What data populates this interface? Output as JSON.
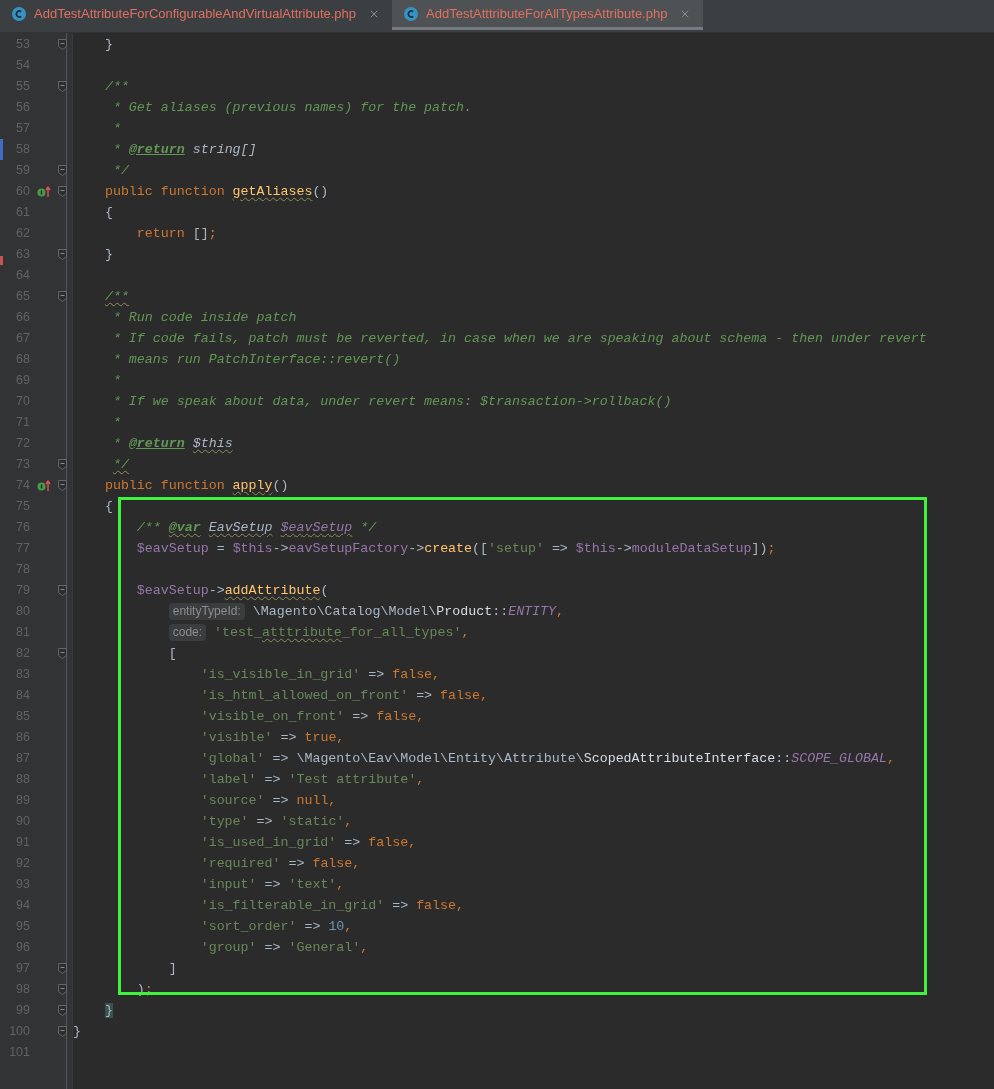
{
  "tabs": [
    {
      "label": "AddTestAttributeForConfigurableAndVirtualAttribute.php",
      "selected": false
    },
    {
      "label": "AddTestAtttributeForAllTypesAttribute.php",
      "selected": true
    }
  ],
  "lines": [
    {
      "number": "53",
      "fold": true,
      "tokens": [
        {
          "text": "    }",
          "kind": "plain"
        }
      ]
    },
    {
      "number": "54",
      "fold": false
    },
    {
      "number": "55",
      "fold": true,
      "tokens": [
        {
          "text": "    /**",
          "kind": "comment"
        }
      ]
    },
    {
      "number": "56",
      "fold": false,
      "tokens": [
        {
          "text": "     * Get aliases (previous names) for the patch.",
          "kind": "comment"
        }
      ]
    },
    {
      "number": "57",
      "fold": false,
      "tokens": [
        {
          "text": "     *",
          "kind": "comment"
        }
      ]
    },
    {
      "number": "58",
      "fold": false,
      "changed": true,
      "tokens": [
        {
          "text": "     * ",
          "kind": "comment"
        },
        {
          "text": "@return",
          "kind": "tag"
        },
        {
          "text": " string[]",
          "kind": "doctype"
        }
      ]
    },
    {
      "number": "59",
      "fold": true,
      "tokens": [
        {
          "text": "     */",
          "kind": "comment"
        }
      ]
    },
    {
      "number": "60",
      "fold": true,
      "override": true,
      "tokens": [
        {
          "text": "    public function ",
          "kind": "keyword"
        },
        {
          "text": "getAliases",
          "kind": "function",
          "squiggle": true
        },
        {
          "text": "()",
          "kind": "plain"
        }
      ]
    },
    {
      "number": "61",
      "fold": false,
      "tokens": [
        {
          "text": "    {",
          "kind": "plain"
        }
      ]
    },
    {
      "number": "62",
      "fold": false,
      "tokens": [
        {
          "text": "        return",
          "kind": "keyword"
        },
        {
          "text": " []",
          "kind": "plain"
        },
        {
          "text": ";",
          "kind": "keyword"
        }
      ]
    },
    {
      "number": "63",
      "fold": true,
      "removed": true,
      "tokens": [
        {
          "text": "    }",
          "kind": "plain"
        }
      ]
    },
    {
      "number": "64",
      "fold": false
    },
    {
      "number": "65",
      "fold": true,
      "tokens": [
        {
          "text": "    /**",
          "kind": "comment",
          "squiggle": true
        }
      ]
    },
    {
      "number": "66",
      "fold": false,
      "tokens": [
        {
          "text": "     * Run code inside patch",
          "kind": "comment"
        }
      ]
    },
    {
      "number": "67",
      "fold": false,
      "tokens": [
        {
          "text": "     * If code fails, patch must be reverted, in case when we are speaking about schema - then under revert",
          "kind": "comment"
        }
      ]
    },
    {
      "number": "68",
      "fold": false,
      "tokens": [
        {
          "text": "     * means run PatchInterface::revert()",
          "kind": "comment"
        }
      ]
    },
    {
      "number": "69",
      "fold": false,
      "tokens": [
        {
          "text": "     *",
          "kind": "comment"
        }
      ]
    },
    {
      "number": "70",
      "fold": false,
      "tokens": [
        {
          "text": "     * If we speak about data, under revert means: $transaction->rollback()",
          "kind": "comment"
        }
      ]
    },
    {
      "number": "71",
      "fold": false,
      "tokens": [
        {
          "text": "     *",
          "kind": "comment"
        }
      ]
    },
    {
      "number": "72",
      "fold": false,
      "tokens": [
        {
          "text": "     * ",
          "kind": "comment"
        },
        {
          "text": "@return",
          "kind": "tag"
        },
        {
          "text": " $this",
          "kind": "doctype",
          "squiggle": true
        }
      ]
    },
    {
      "number": "73",
      "fold": true,
      "tokens": [
        {
          "text": "     */",
          "kind": "comment",
          "squiggle": true
        }
      ]
    },
    {
      "number": "74",
      "fold": true,
      "override": true,
      "tokens": [
        {
          "text": "    public function ",
          "kind": "keyword"
        },
        {
          "text": "apply",
          "kind": "function",
          "squiggle": true
        },
        {
          "text": "()",
          "kind": "plain"
        }
      ]
    },
    {
      "number": "75",
      "fold": false,
      "tokens": [
        {
          "text": "    {",
          "kind": "plain"
        }
      ]
    },
    {
      "number": "76",
      "fold": false,
      "tokens": [
        {
          "text": "        /** ",
          "kind": "comment"
        },
        {
          "text": "@var",
          "kind": "tag",
          "squiggle": true
        },
        {
          "text": " EavSetup",
          "kind": "doctype",
          "squiggle": true
        },
        {
          "text": " $eavSetup",
          "kind": "docvar",
          "squiggle": true
        },
        {
          "text": " */",
          "kind": "comment"
        }
      ]
    },
    {
      "number": "77",
      "fold": false,
      "tokens": [
        {
          "text": "        $eavSetup",
          "kind": "variable"
        },
        {
          "text": " = ",
          "kind": "plain"
        },
        {
          "text": "$this",
          "kind": "variable"
        },
        {
          "text": "->",
          "kind": "plain"
        },
        {
          "text": "eavSetupFactory",
          "kind": "variable"
        },
        {
          "text": "->",
          "kind": "plain"
        },
        {
          "text": "create",
          "kind": "function"
        },
        {
          "text": "([",
          "kind": "plain"
        },
        {
          "text": "'setup'",
          "kind": "string"
        },
        {
          "text": " => ",
          "kind": "plain"
        },
        {
          "text": "$this",
          "kind": "variable"
        },
        {
          "text": "->",
          "kind": "plain"
        },
        {
          "text": "moduleDataSetup",
          "kind": "variable"
        },
        {
          "text": "])",
          "kind": "plain"
        },
        {
          "text": ";",
          "kind": "keyword"
        }
      ]
    },
    {
      "number": "78",
      "fold": false
    },
    {
      "number": "79",
      "fold": true,
      "tokens": [
        {
          "text": "        $eavSetup",
          "kind": "variable"
        },
        {
          "text": "->",
          "kind": "plain"
        },
        {
          "text": "addAttribute",
          "kind": "function",
          "squiggle": true
        },
        {
          "text": "(",
          "kind": "plain"
        }
      ]
    },
    {
      "number": "80",
      "fold": false,
      "tokens": [
        {
          "text": "            entityTypeId:",
          "kind": "hint"
        },
        {
          "text": " \\Magento\\Catalog\\Model\\",
          "kind": "namespace"
        },
        {
          "text": "Product",
          "kind": "class"
        },
        {
          "text": "::",
          "kind": "plain"
        },
        {
          "text": "ENTITY",
          "kind": "constant"
        },
        {
          "text": ",",
          "kind": "keyword"
        }
      ]
    },
    {
      "number": "81",
      "fold": false,
      "tokens": [
        {
          "text": "            code:",
          "kind": "hint"
        },
        {
          "text": " 'test_",
          "kind": "string"
        },
        {
          "text": "atttribute",
          "kind": "string",
          "squiggle": true
        },
        {
          "text": "_for_all_types'",
          "kind": "string"
        },
        {
          "text": ",",
          "kind": "keyword"
        }
      ]
    },
    {
      "number": "82",
      "fold": true,
      "tokens": [
        {
          "text": "            [",
          "kind": "plain"
        }
      ]
    },
    {
      "number": "83",
      "fold": false,
      "tokens": [
        {
          "text": "                'is_visible_in_grid'",
          "kind": "string"
        },
        {
          "text": " => ",
          "kind": "plain"
        },
        {
          "text": "false,",
          "kind": "keyword"
        }
      ]
    },
    {
      "number": "84",
      "fold": false,
      "tokens": [
        {
          "text": "                'is_html_allowed_on_front'",
          "kind": "string"
        },
        {
          "text": " => ",
          "kind": "plain"
        },
        {
          "text": "false,",
          "kind": "keyword"
        }
      ]
    },
    {
      "number": "85",
      "fold": false,
      "tokens": [
        {
          "text": "                'visible_on_front'",
          "kind": "string"
        },
        {
          "text": " => ",
          "kind": "plain"
        },
        {
          "text": "false,",
          "kind": "keyword"
        }
      ]
    },
    {
      "number": "86",
      "fold": false,
      "tokens": [
        {
          "text": "                'visible'",
          "kind": "string"
        },
        {
          "text": " => ",
          "kind": "plain"
        },
        {
          "text": "true,",
          "kind": "keyword"
        }
      ]
    },
    {
      "number": "87",
      "fold": false,
      "tokens": [
        {
          "text": "                'global'",
          "kind": "string"
        },
        {
          "text": " => ",
          "kind": "plain"
        },
        {
          "text": "\\Magento\\Eav\\Model\\Entity\\Attribute\\",
          "kind": "namespace"
        },
        {
          "text": "ScopedAttributeInterface",
          "kind": "class"
        },
        {
          "text": "::",
          "kind": "plain"
        },
        {
          "text": "SCOPE_GLOBAL",
          "kind": "constant"
        },
        {
          "text": ",",
          "kind": "keyword"
        }
      ]
    },
    {
      "number": "88",
      "fold": false,
      "tokens": [
        {
          "text": "                'label'",
          "kind": "string"
        },
        {
          "text": " => ",
          "kind": "plain"
        },
        {
          "text": "'Test attribute'",
          "kind": "string"
        },
        {
          "text": ",",
          "kind": "keyword"
        }
      ]
    },
    {
      "number": "89",
      "fold": false,
      "tokens": [
        {
          "text": "                'source'",
          "kind": "string"
        },
        {
          "text": " => ",
          "kind": "plain"
        },
        {
          "text": "null,",
          "kind": "keyword"
        }
      ]
    },
    {
      "number": "90",
      "fold": false,
      "tokens": [
        {
          "text": "                'type'",
          "kind": "string"
        },
        {
          "text": " => ",
          "kind": "plain"
        },
        {
          "text": "'static'",
          "kind": "string"
        },
        {
          "text": ",",
          "kind": "keyword"
        }
      ]
    },
    {
      "number": "91",
      "fold": false,
      "tokens": [
        {
          "text": "                'is_used_in_grid'",
          "kind": "string"
        },
        {
          "text": " => ",
          "kind": "plain"
        },
        {
          "text": "false,",
          "kind": "keyword"
        }
      ]
    },
    {
      "number": "92",
      "fold": false,
      "tokens": [
        {
          "text": "                'required'",
          "kind": "string"
        },
        {
          "text": " => ",
          "kind": "plain"
        },
        {
          "text": "false,",
          "kind": "keyword"
        }
      ]
    },
    {
      "number": "93",
      "fold": false,
      "tokens": [
        {
          "text": "                'input'",
          "kind": "string"
        },
        {
          "text": " => ",
          "kind": "plain"
        },
        {
          "text": "'text'",
          "kind": "string"
        },
        {
          "text": ",",
          "kind": "keyword"
        }
      ]
    },
    {
      "number": "94",
      "fold": false,
      "tokens": [
        {
          "text": "                'is_filterable_in_grid'",
          "kind": "string"
        },
        {
          "text": " => ",
          "kind": "plain"
        },
        {
          "text": "false,",
          "kind": "keyword"
        }
      ]
    },
    {
      "number": "95",
      "fold": false,
      "tokens": [
        {
          "text": "                'sort_order'",
          "kind": "string"
        },
        {
          "text": " => ",
          "kind": "plain"
        },
        {
          "text": "10",
          "kind": "number"
        },
        {
          "text": ",",
          "kind": "keyword"
        }
      ]
    },
    {
      "number": "96",
      "fold": false,
      "tokens": [
        {
          "text": "                'group'",
          "kind": "string"
        },
        {
          "text": " => ",
          "kind": "plain"
        },
        {
          "text": "'General'",
          "kind": "string"
        },
        {
          "text": ",",
          "kind": "keyword"
        }
      ]
    },
    {
      "number": "97",
      "fold": true,
      "tokens": [
        {
          "text": "            ]",
          "kind": "plain"
        }
      ]
    },
    {
      "number": "98",
      "fold": true,
      "tokens": [
        {
          "text": "        )",
          "kind": "plain"
        },
        {
          "text": ";",
          "kind": "keyword"
        }
      ]
    },
    {
      "number": "99",
      "fold": true,
      "tokens": [
        {
          "text": "    }",
          "kind": "brace-match"
        }
      ]
    },
    {
      "number": "100",
      "fold": true,
      "tokens": [
        {
          "text": "}",
          "kind": "plain"
        }
      ]
    },
    {
      "number": "101",
      "fold": false
    }
  ]
}
